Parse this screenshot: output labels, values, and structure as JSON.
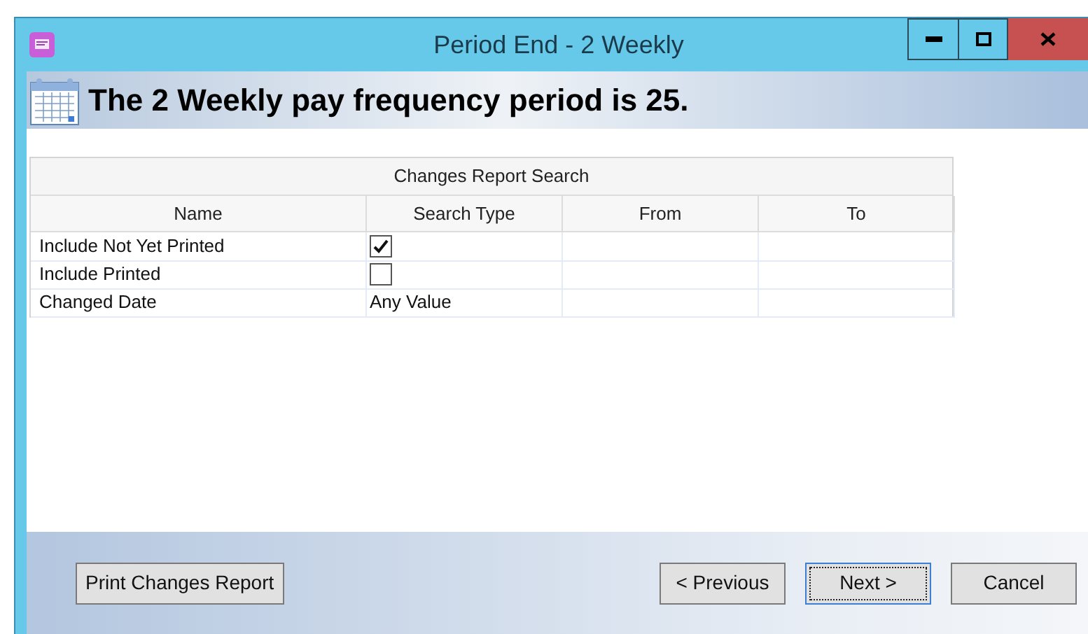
{
  "window": {
    "title": "Period End - 2 Weekly"
  },
  "header": {
    "text": "The 2 Weekly pay frequency period is 25."
  },
  "table": {
    "title": "Changes Report Search",
    "columns": [
      "Name",
      "Search Type",
      "From",
      "To"
    ],
    "rows": [
      {
        "name": "Include Not Yet Printed",
        "kind": "checkbox",
        "checked": true
      },
      {
        "name": "Include Printed",
        "kind": "checkbox",
        "checked": false
      },
      {
        "name": "Changed Date",
        "kind": "text",
        "value": "Any Value"
      }
    ]
  },
  "buttons": {
    "left": [
      {
        "label": "Print Changes Report",
        "focused": false
      }
    ],
    "right": [
      {
        "label": "< Previous",
        "focused": false
      },
      {
        "label": "Next >",
        "focused": true
      },
      {
        "label": "Cancel",
        "focused": false
      }
    ]
  }
}
